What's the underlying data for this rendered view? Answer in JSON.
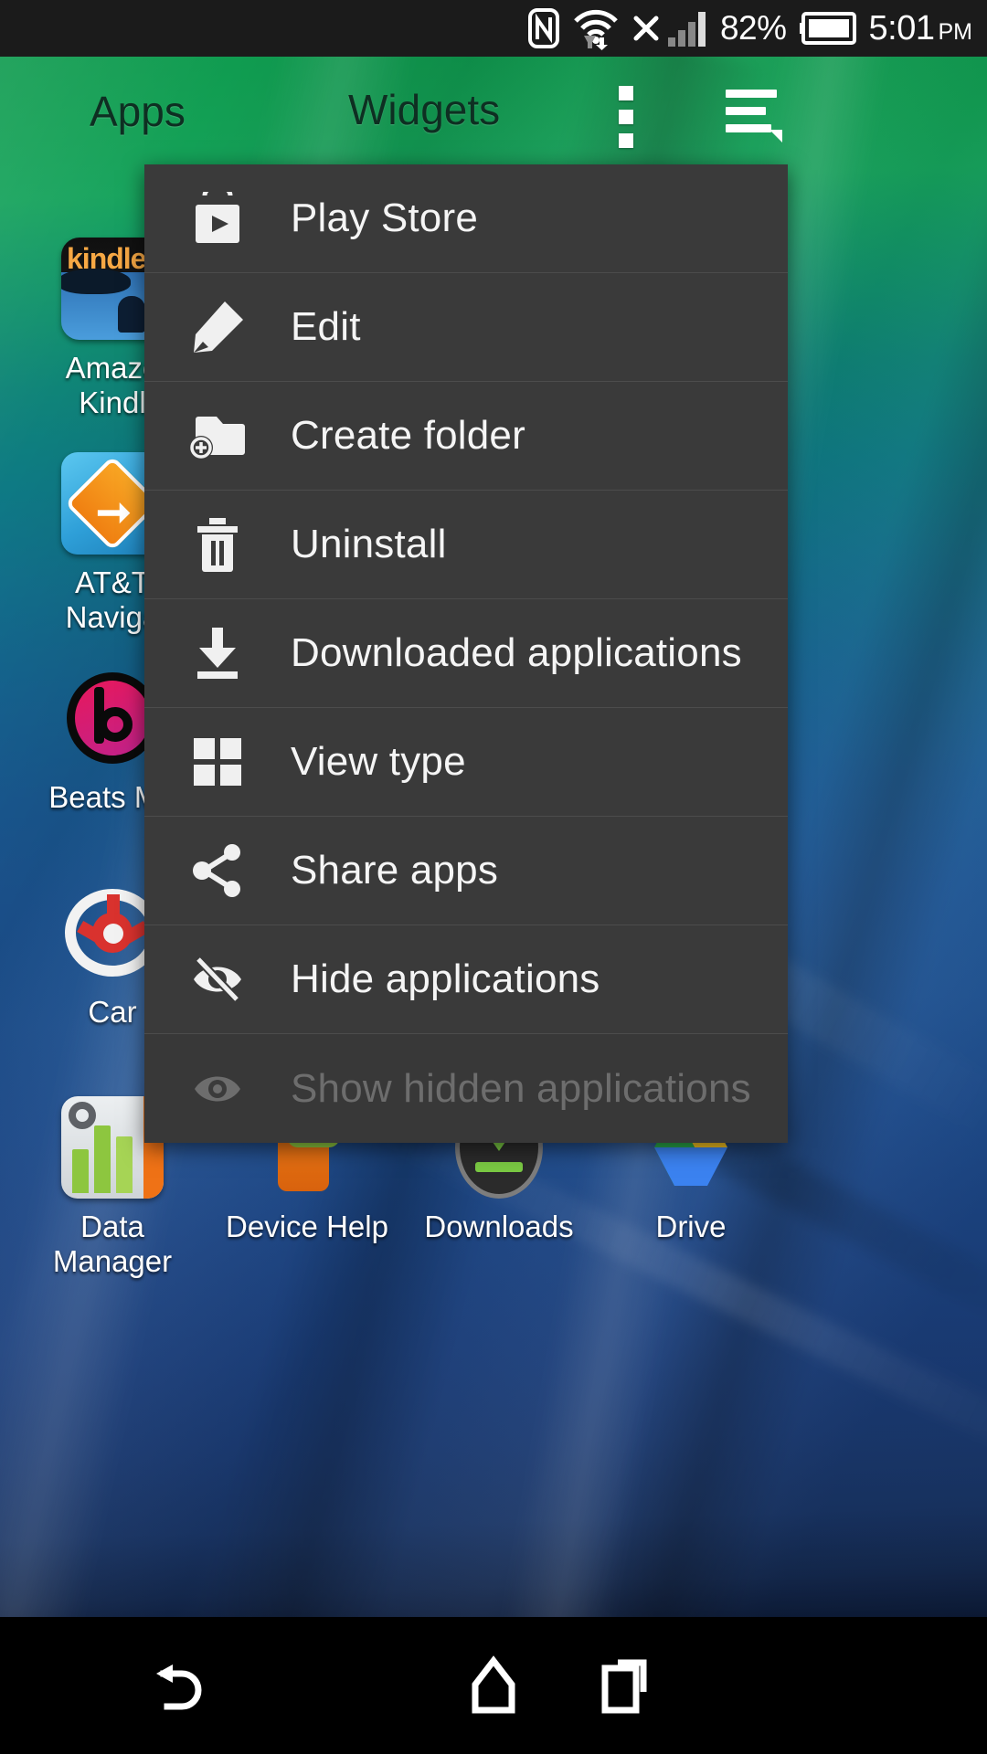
{
  "status_bar": {
    "icons": [
      "nfc-icon",
      "wifi-icon",
      "no-signal-x-icon",
      "cellular-signal-icon"
    ],
    "battery_percent": "82%",
    "battery_icon": "battery-icon",
    "time": "5:01",
    "am_pm": "PM"
  },
  "header": {
    "tabs": [
      {
        "label": "Apps",
        "selected": true
      },
      {
        "label": "Widgets",
        "selected": false
      }
    ],
    "overflow_button": "overflow-menu-button",
    "list_button": "list-view-button"
  },
  "menu": {
    "items": [
      {
        "label": "Play Store",
        "icon": "play-store-icon",
        "enabled": true
      },
      {
        "label": "Edit",
        "icon": "pencil-icon",
        "enabled": true
      },
      {
        "label": "Create folder",
        "icon": "folder-add-icon",
        "enabled": true
      },
      {
        "label": "Uninstall",
        "icon": "trash-icon",
        "enabled": true
      },
      {
        "label": "Downloaded applications",
        "icon": "download-icon",
        "enabled": true
      },
      {
        "label": "View type",
        "icon": "grid-icon",
        "enabled": true
      },
      {
        "label": "Share apps",
        "icon": "share-icon",
        "enabled": true
      },
      {
        "label": "Hide applications",
        "icon": "eye-slash-icon",
        "enabled": true
      },
      {
        "label": "Show hidden applications",
        "icon": "eye-icon",
        "enabled": false
      }
    ]
  },
  "apps": {
    "column_left": [
      {
        "label": "Amazon\nKindle",
        "label_line1": "Amazo",
        "label_line2": "Kindl",
        "icon": "amazon-kindle-icon"
      },
      {
        "label": "AT&T Navigator",
        "label_line1": "AT&T",
        "label_line2": "Naviga",
        "icon": "att-navigator-icon"
      },
      {
        "label": "Beats Music",
        "label_line1": "Beats Mu",
        "label_line2": "",
        "icon": "beats-music-icon"
      },
      {
        "label": "Car",
        "label_line1": "Car",
        "label_line2": "",
        "icon": "car-icon"
      }
    ],
    "row_bottom": [
      {
        "label_line1": "Data",
        "label_line2": "Manager",
        "icon": "data-manager-icon"
      },
      {
        "label_line1": "Device Help",
        "label_line2": "",
        "icon": "device-help-icon"
      },
      {
        "label_line1": "Downloads",
        "label_line2": "",
        "icon": "downloads-icon"
      },
      {
        "label_line1": "Drive",
        "label_line2": "",
        "icon": "google-drive-icon"
      }
    ]
  },
  "nav_bar": {
    "back": "back-button",
    "home": "home-button",
    "recents": "recents-button"
  },
  "colors": {
    "status_bar_bg": "#1b1b1b",
    "menu_bg": "#3a3a3a",
    "menu_divider": "#4c4c4c",
    "menu_text": "#f5f5f5",
    "menu_disabled_text": "#6d6d6d",
    "wallpaper_top": "#16a35c",
    "wallpaper_bottom": "#0c1a36",
    "nav_bar_bg": "#000000"
  }
}
